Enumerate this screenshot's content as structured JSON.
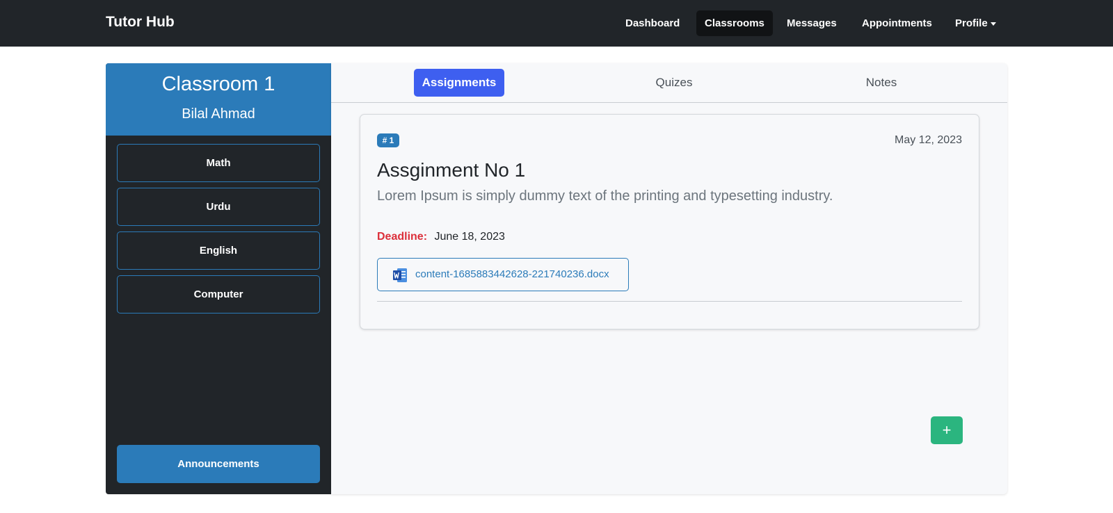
{
  "navbar": {
    "brand": "Tutor Hub",
    "links": [
      {
        "label": "Dashboard"
      },
      {
        "label": "Classrooms"
      },
      {
        "label": "Messages"
      },
      {
        "label": "Appointments"
      },
      {
        "label": "Profile"
      }
    ]
  },
  "sidebar": {
    "title": "Classroom 1",
    "teacher": "Bilal Ahmad",
    "subjects": [
      {
        "label": "Math"
      },
      {
        "label": "Urdu"
      },
      {
        "label": "English"
      },
      {
        "label": "Computer"
      }
    ],
    "announcements_label": "Announcements"
  },
  "main": {
    "tabs": [
      {
        "label": "Assignments"
      },
      {
        "label": "Quizes"
      },
      {
        "label": "Notes"
      }
    ],
    "assignment": {
      "badge": "# 1",
      "date": "May 12, 2023",
      "title": "Assginment No 1",
      "description": "Lorem Ipsum is simply dummy text of the printing and typesetting industry.",
      "deadline_label": "Deadline:",
      "deadline_value": "June 18, 2023",
      "file_name": "content-1685883442628-221740236.docx",
      "file_icon": "word-document-icon"
    },
    "add_button_label": "+"
  },
  "colors": {
    "navbar_bg": "#212529",
    "accent_blue": "#2b7bb9",
    "active_tab": "#3e5ff0",
    "deadline_red": "#dc2f3a",
    "add_green": "#2bb57f"
  }
}
